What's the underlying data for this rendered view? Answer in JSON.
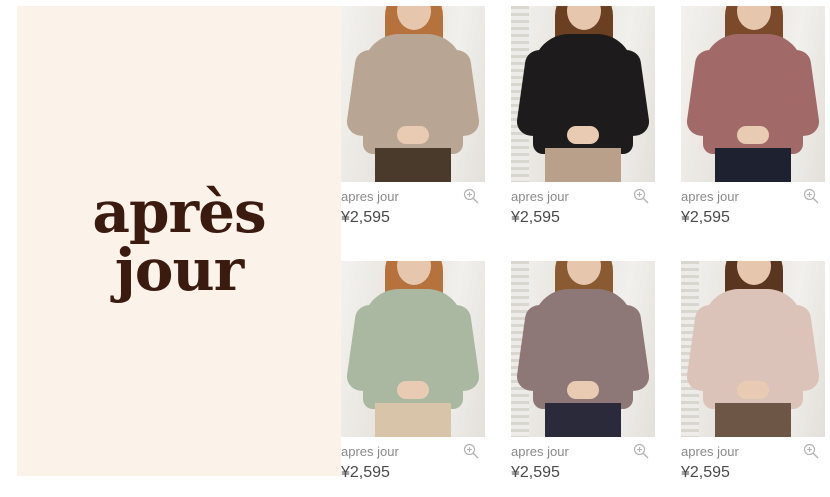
{
  "brand_logo": {
    "line1": "après",
    "line2": "jour"
  },
  "products": [
    {
      "brand": "apres jour",
      "price": "¥2,595",
      "sweater_color": "#b9a593",
      "lower_color": "#4a3a2c",
      "hair_color": "#b5723d"
    },
    {
      "brand": "apres jour",
      "price": "¥2,595",
      "sweater_color": "#1d1b1b",
      "lower_color": "#b9a08a",
      "hair_color": "#6a3f22"
    },
    {
      "brand": "apres jour",
      "price": "¥2,595",
      "sweater_color": "#a16a69",
      "lower_color": "#1e2230",
      "hair_color": "#7a4a2a"
    },
    {
      "brand": "apres jour",
      "price": "¥2,595",
      "sweater_color": "#aab8a2",
      "lower_color": "#d8c4a8",
      "hair_color": "#b5723d"
    },
    {
      "brand": "apres jour",
      "price": "¥2,595",
      "sweater_color": "#8d7877",
      "lower_color": "#2a2a3a",
      "hair_color": "#8a5a33"
    },
    {
      "brand": "apres jour",
      "price": "¥2,595",
      "sweater_color": "#dcc3b9",
      "lower_color": "#6e5646",
      "hair_color": "#5a3520"
    }
  ],
  "icons": {
    "zoom": "zoom-in-icon"
  },
  "colors": {
    "brand_panel_bg": "#fbf3e9",
    "logo_text": "#3b1a10"
  }
}
